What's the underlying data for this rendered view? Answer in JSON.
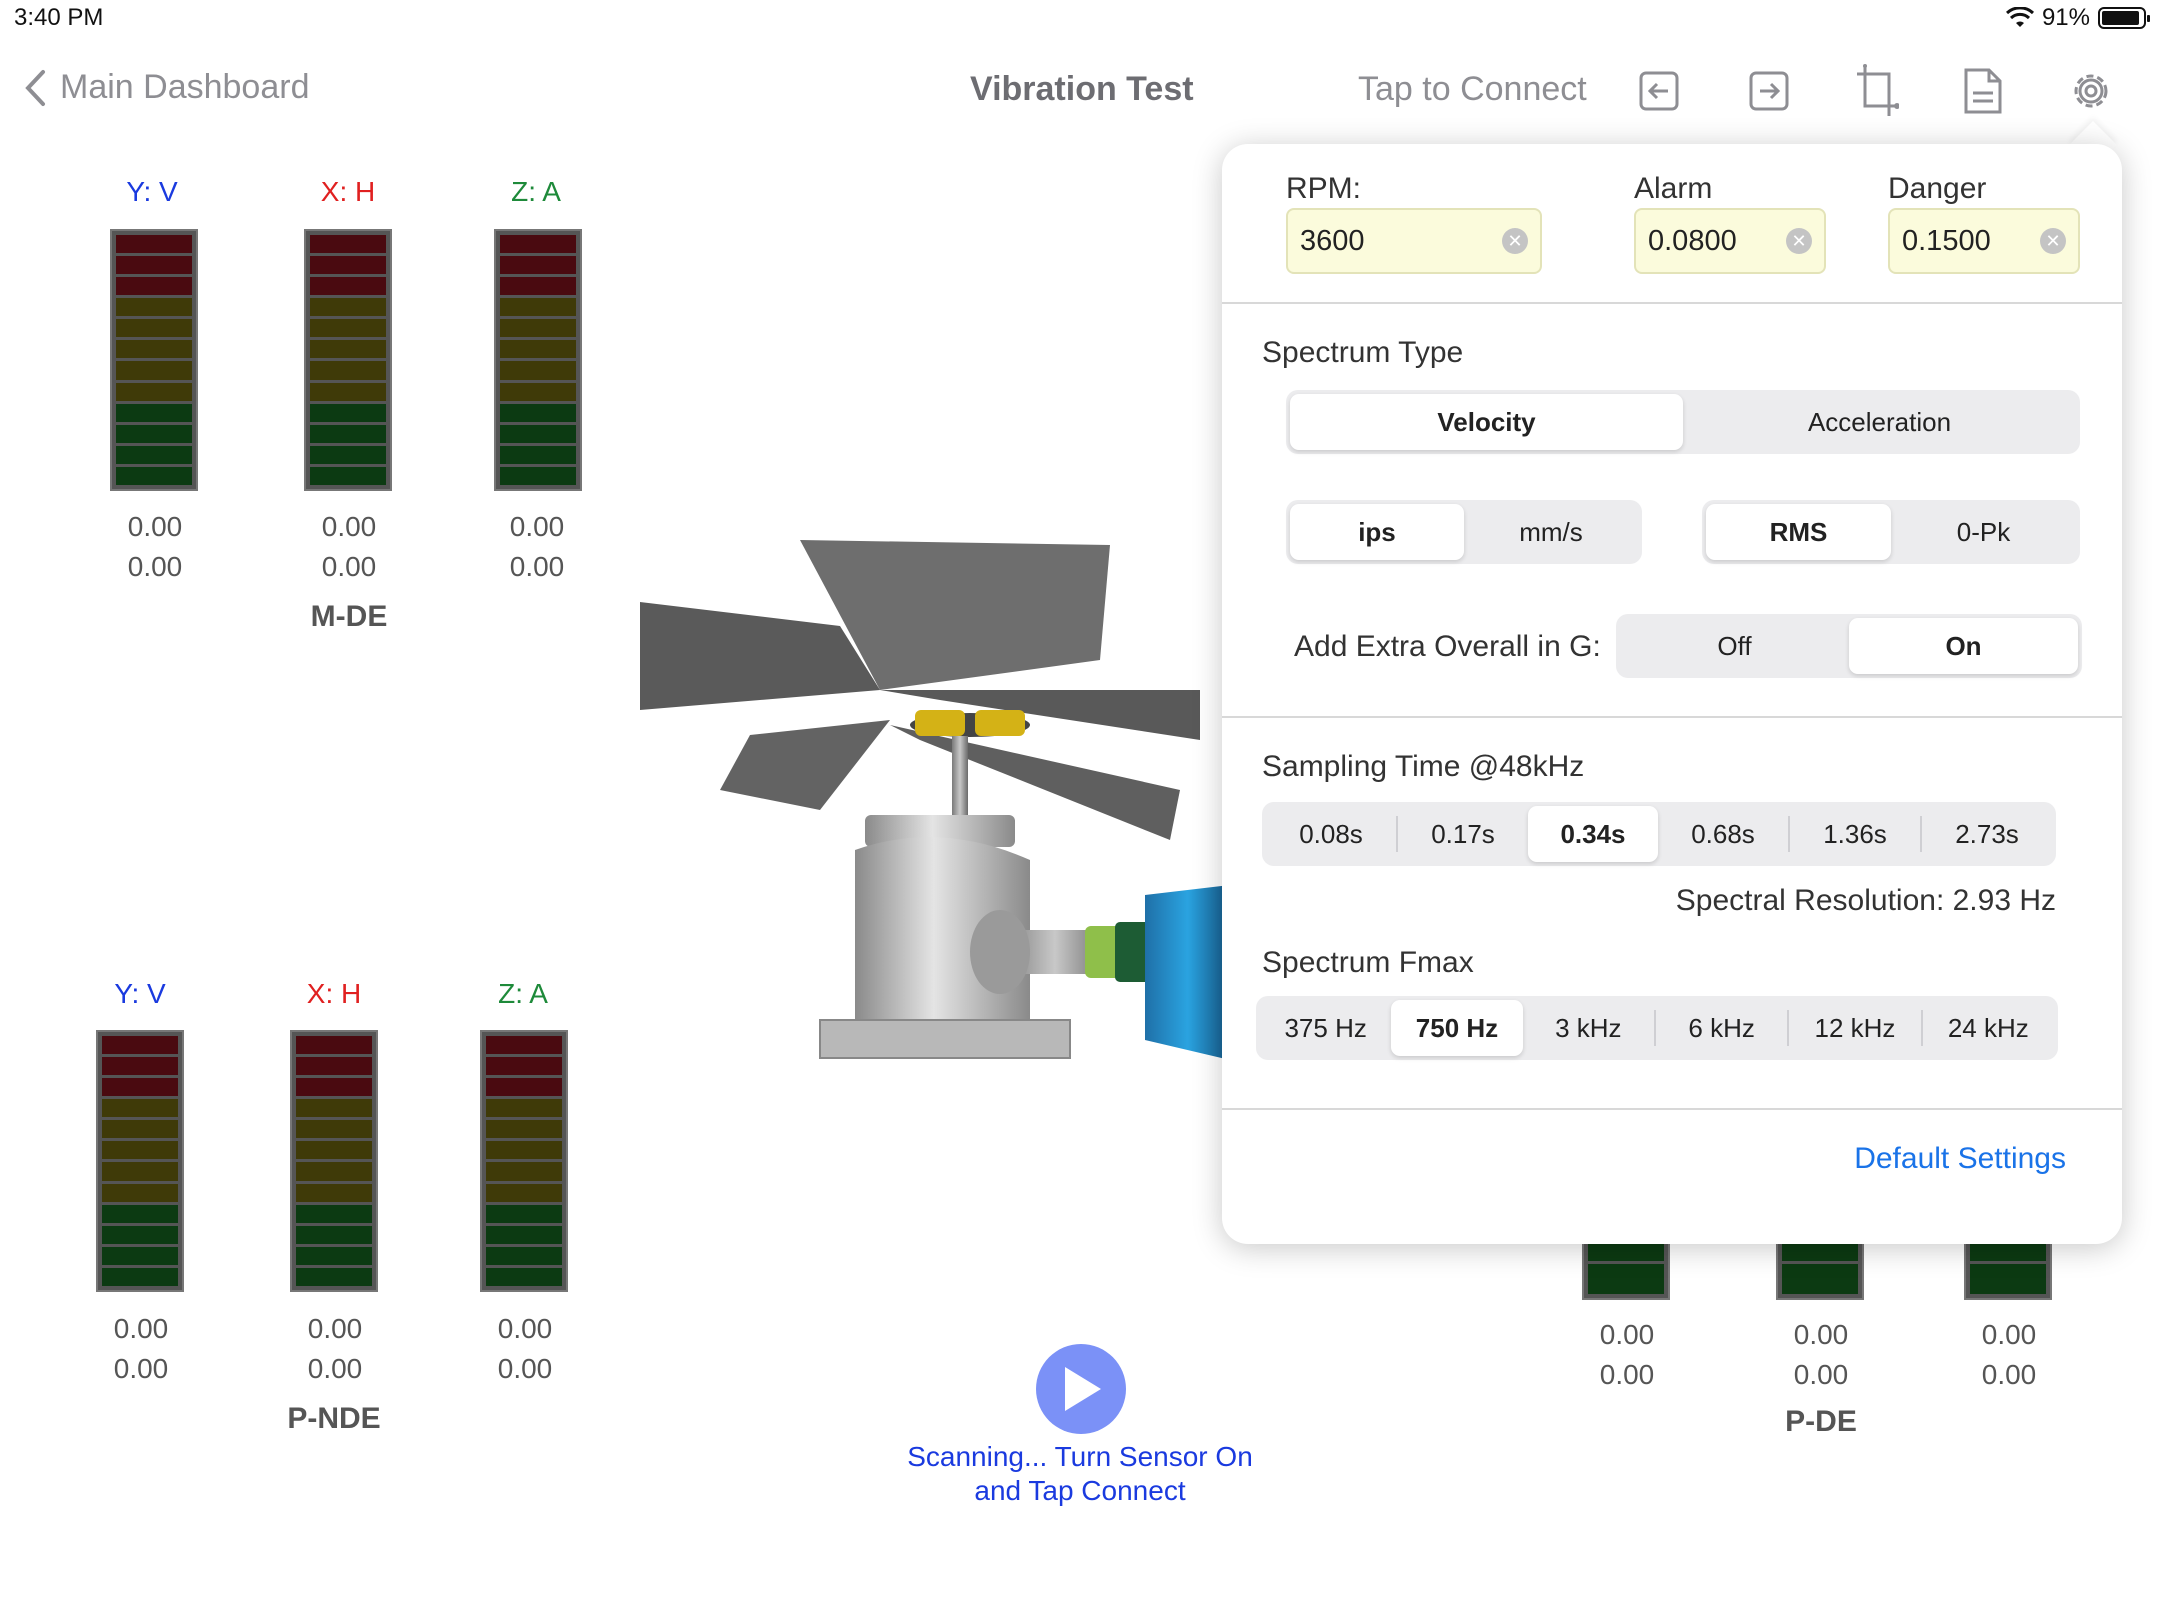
{
  "status": {
    "time": "3:40 PM",
    "battery": "91%"
  },
  "nav": {
    "back_label": "Main Dashboard",
    "title": "Vibration Test",
    "connect_label": "Tap to Connect"
  },
  "colors": {
    "axis_y": "#1a3adf",
    "axis_x": "#e02020",
    "axis_z": "#1e8a3a",
    "link": "#1a73e8"
  },
  "groups": {
    "mde": {
      "name": "M-DE",
      "axes": [
        {
          "label": "Y: V",
          "v1": "0.00",
          "v2": "0.00"
        },
        {
          "label": "X: H",
          "v1": "0.00",
          "v2": "0.00"
        },
        {
          "label": "Z: A",
          "v1": "0.00",
          "v2": "0.00"
        }
      ]
    },
    "pnde": {
      "name": "P-NDE",
      "axes": [
        {
          "label": "Y: V",
          "v1": "0.00",
          "v2": "0.00"
        },
        {
          "label": "X: H",
          "v1": "0.00",
          "v2": "0.00"
        },
        {
          "label": "Z: A",
          "v1": "0.00",
          "v2": "0.00"
        }
      ]
    },
    "pde": {
      "name": "P-DE",
      "axes": [
        {
          "v1": "0.00",
          "v2": "0.00"
        },
        {
          "v1": "0.00",
          "v2": "0.00"
        },
        {
          "v1": "0.00",
          "v2": "0.00"
        }
      ]
    }
  },
  "scan": {
    "line1": "Scanning... Turn Sensor On",
    "line2": "and Tap Connect"
  },
  "settings": {
    "rpm": {
      "label": "RPM:",
      "value": "3600"
    },
    "alarm": {
      "label": "Alarm",
      "value": "0.0800"
    },
    "danger": {
      "label": "Danger",
      "value": "0.1500"
    },
    "spectrum_type": {
      "title": "Spectrum Type",
      "options": [
        "Velocity",
        "Acceleration"
      ],
      "selected": "Velocity"
    },
    "units": {
      "options": [
        "ips",
        "mm/s"
      ],
      "selected": "ips"
    },
    "amplitude": {
      "options": [
        "RMS",
        "0-Pk"
      ],
      "selected": "RMS"
    },
    "extra_overall": {
      "label": "Add Extra Overall in G:",
      "options": [
        "Off",
        "On"
      ],
      "selected": "On"
    },
    "sampling": {
      "title": "Sampling Time @48kHz",
      "options": [
        "0.08s",
        "0.17s",
        "0.34s",
        "0.68s",
        "1.36s",
        "2.73s"
      ],
      "selected": "0.34s"
    },
    "resolution": "Spectral Resolution: 2.93 Hz",
    "fmax": {
      "title": "Spectrum Fmax",
      "options": [
        "375 Hz",
        "750 Hz",
        "3 kHz",
        "6 kHz",
        "12 kHz",
        "24 kHz"
      ],
      "selected": "750 Hz"
    },
    "default_label": "Default Settings"
  }
}
